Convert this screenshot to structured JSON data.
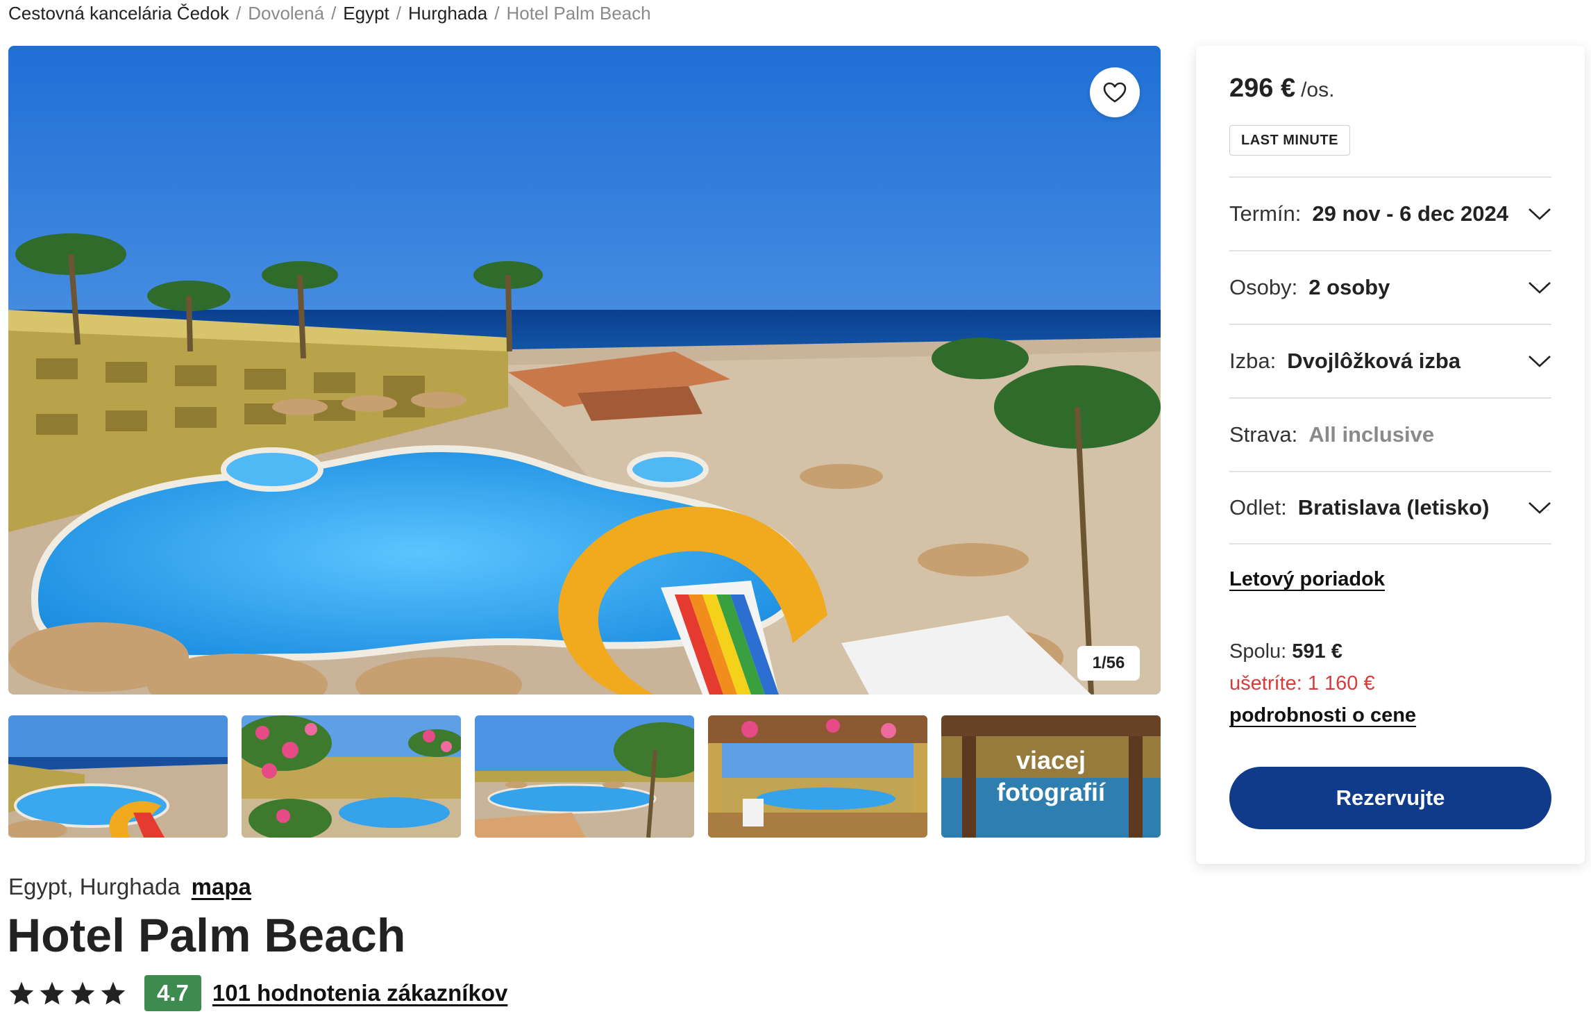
{
  "breadcrumb": [
    {
      "label": "Cestovná kancelária Čedok",
      "muted": false
    },
    {
      "label": "Dovolená",
      "muted": true
    },
    {
      "label": "Egypt",
      "muted": false
    },
    {
      "label": "Hurghada",
      "muted": false
    },
    {
      "label": "Hotel Palm Beach",
      "muted": true
    }
  ],
  "gallery": {
    "counter": "1/56",
    "favorite_icon": "heart-outline-icon",
    "more_label_line1": "viacej",
    "more_label_line2": "fotografií",
    "thumbnails": [
      "pool-slide",
      "garden-flowers",
      "pool-palms",
      "balcony-view",
      "more-photos"
    ]
  },
  "hotel": {
    "location": "Egypt, Hurghada",
    "map_link": "mapa",
    "name": "Hotel Palm Beach",
    "stars": 4,
    "score": "4.7",
    "reviews_link": "101 hodnotenia zákazníkov"
  },
  "booking": {
    "price": "296 €",
    "price_unit": "/os.",
    "badge": "LAST MINUTE",
    "term_label": "Termín:",
    "term_value": "29 nov - 6 dec 2024",
    "persons_label": "Osoby:",
    "persons_value": "2 osoby",
    "room_label": "Izba:",
    "room_value": "Dvojlôžková izba",
    "board_label": "Strava:",
    "board_value": "All inclusive",
    "departure_label": "Odlet:",
    "departure_value": "Bratislava (letisko)",
    "flight_schedule_link": "Letový poriadok",
    "total_label": "Spolu:",
    "total_value": "591 €",
    "savings": "ušetríte: 1 160 €",
    "price_details_link": "podrobnosti o cene",
    "reserve_button": "Rezervujte"
  },
  "colors": {
    "primary_button": "#103b8a",
    "score_badge": "#3d8b4f",
    "savings_text": "#d93b3b"
  }
}
